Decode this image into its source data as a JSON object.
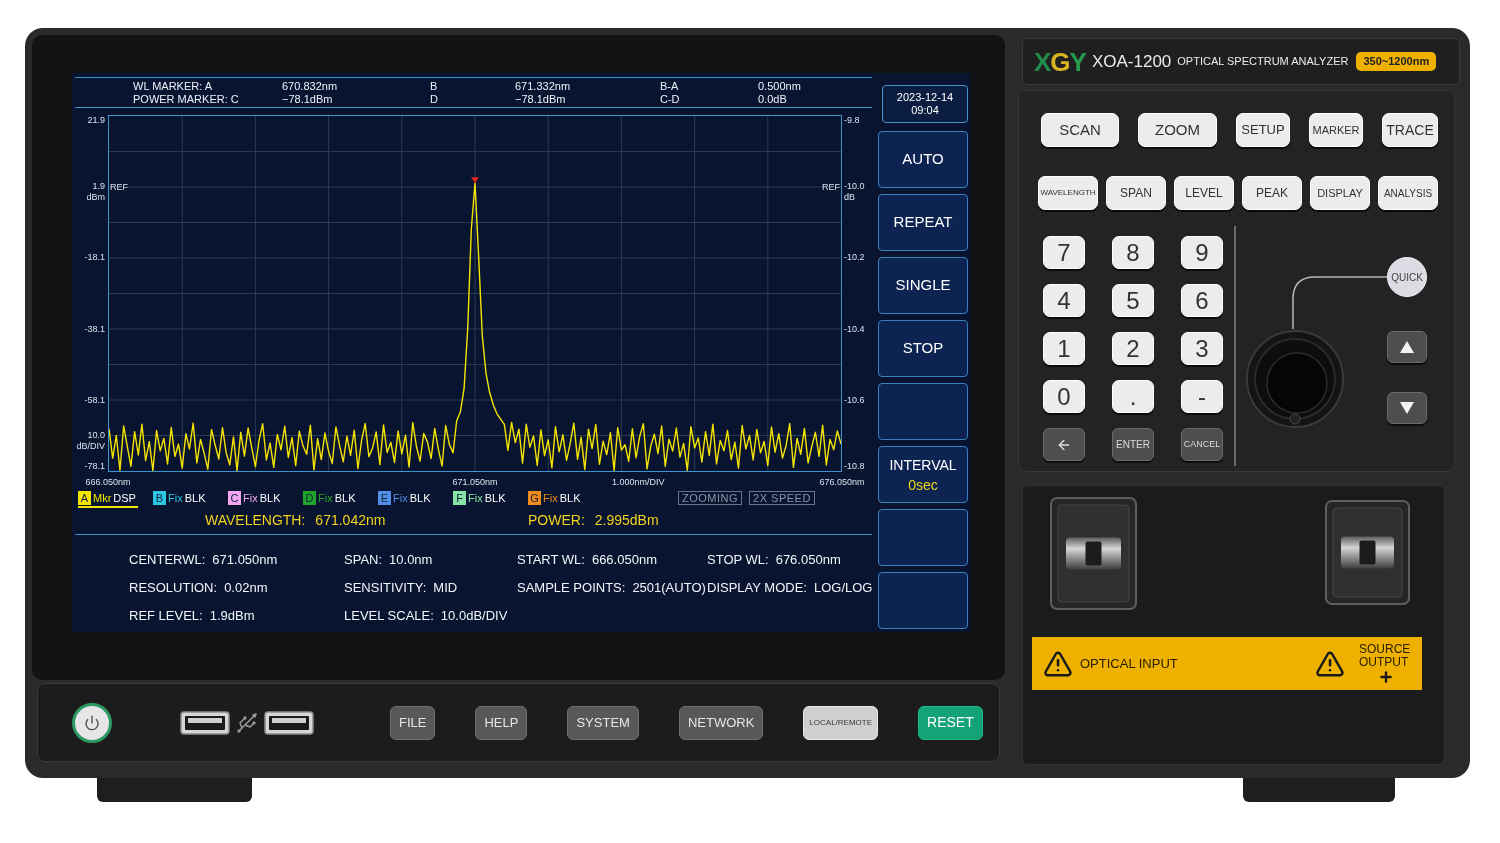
{
  "device": {
    "brand": "XGY",
    "model": "XOA-1200",
    "product": "OPTICAL SPECTRUM ANALYZER",
    "range_badge": "350~1200nm"
  },
  "screen": {
    "marker_table": [
      [
        "WL MARKER: A",
        "670.832nm",
        "B",
        "671.332nm",
        "B-A",
        "0.500nm"
      ],
      [
        "POWER MARKER: C",
        "−78.1dBm",
        "D",
        "−78.1dBm",
        "C-D",
        "0.0dB"
      ]
    ],
    "datetime": {
      "date": "2023-12-14",
      "time": "09:04"
    },
    "left_axis": {
      "ref_label": "REF",
      "unit": "dBm",
      "scale_value": "10.0",
      "scale_unit": "dB/DIV"
    },
    "right_axis": {
      "ref_label": "REF",
      "unit": "dB",
      "ticks": [
        "-9.8",
        "-10.0",
        "-10.2",
        "-10.4",
        "-10.6",
        "-10.8"
      ]
    },
    "x_scale": "1.000nm/DIV",
    "chart_data": {
      "type": "line",
      "grid": true,
      "xlim": [
        666.05,
        676.05
      ],
      "ylim": [
        -78.1,
        21.9
      ],
      "xticks": [
        {
          "value": 666.05,
          "label": "666.050nm"
        },
        {
          "value": 671.05,
          "label": "671.050nm"
        },
        {
          "value": 676.05,
          "label": "676.050nm"
        }
      ],
      "yticks": [
        21.9,
        1.9,
        -18.1,
        -38.1,
        -58.1,
        -78.1
      ],
      "x": [
        666.05,
        666.1,
        666.15,
        666.2,
        666.25,
        666.3,
        666.35,
        666.4,
        666.45,
        666.5,
        666.55,
        666.6,
        666.65,
        666.7,
        666.75,
        666.8,
        666.85,
        666.9,
        666.95,
        667,
        667.05,
        667.1,
        667.15,
        667.2,
        667.25,
        667.3,
        667.35,
        667.4,
        667.45,
        667.5,
        667.55,
        667.6,
        667.65,
        667.7,
        667.75,
        667.8,
        667.85,
        667.9,
        667.95,
        668,
        668.05,
        668.1,
        668.15,
        668.2,
        668.25,
        668.3,
        668.35,
        668.4,
        668.45,
        668.5,
        668.55,
        668.6,
        668.65,
        668.7,
        668.75,
        668.8,
        668.85,
        668.9,
        668.95,
        669,
        669.05,
        669.1,
        669.15,
        669.2,
        669.25,
        669.3,
        669.35,
        669.4,
        669.45,
        669.5,
        669.55,
        669.6,
        669.65,
        669.7,
        669.75,
        669.8,
        669.85,
        669.9,
        669.95,
        670,
        670.05,
        670.1,
        670.15,
        670.2,
        670.25,
        670.3,
        670.35,
        670.4,
        670.45,
        670.5,
        670.55,
        670.6,
        670.65,
        670.7,
        670.75,
        670.8,
        670.85,
        670.9,
        670.95,
        671,
        671.05,
        671.1,
        671.15,
        671.2,
        671.25,
        671.3,
        671.35,
        671.4,
        671.45,
        671.5,
        671.55,
        671.6,
        671.65,
        671.7,
        671.75,
        671.8,
        671.85,
        671.9,
        671.95,
        672,
        672.05,
        672.1,
        672.15,
        672.2,
        672.25,
        672.3,
        672.35,
        672.4,
        672.45,
        672.5,
        672.55,
        672.6,
        672.65,
        672.7,
        672.75,
        672.8,
        672.85,
        672.9,
        672.95,
        673,
        673.05,
        673.1,
        673.15,
        673.2,
        673.25,
        673.3,
        673.35,
        673.4,
        673.45,
        673.5,
        673.55,
        673.6,
        673.65,
        673.7,
        673.75,
        673.8,
        673.85,
        673.9,
        673.95,
        674,
        674.05,
        674.1,
        674.15,
        674.2,
        674.25,
        674.3,
        674.35,
        674.4,
        674.45,
        674.5,
        674.55,
        674.6,
        674.65,
        674.7,
        674.75,
        674.8,
        674.85,
        674.9,
        674.95,
        675,
        675.05,
        675.1,
        675.15,
        675.2,
        675.25,
        675.3,
        675.35,
        675.4,
        675.45,
        675.5,
        675.55,
        675.6,
        675.65,
        675.7,
        675.75,
        675.8,
        675.85,
        675.9,
        675.95,
        676,
        676.05
      ],
      "series": [
        {
          "color": "#f5e400",
          "values": [
            -66.2,
            -74.5,
            -68.1,
            -77.9,
            -65.4,
            -71.3,
            -76.8,
            -67.0,
            -73.6,
            -64.9,
            -75.2,
            -69.8,
            -78.0,
            -66.7,
            -72.4,
            -68.9,
            -76.1,
            -65.8,
            -74.0,
            -70.5,
            -77.3,
            -67.6,
            -71.9,
            -64.6,
            -75.8,
            -69.2,
            -73.1,
            -77.6,
            -66.4,
            -70.8,
            -74.7,
            -65.9,
            -72.8,
            -76.4,
            -68.5,
            -78.0,
            -67.2,
            -73.9,
            -66.0,
            -71.5,
            -76.9,
            -69.4,
            -64.8,
            -75.0,
            -70.2,
            -77.1,
            -67.8,
            -72.1,
            -65.5,
            -74.3,
            -68.7,
            -76.6,
            -66.9,
            -71.0,
            -73.4,
            -65.2,
            -77.8,
            -69.0,
            -74.9,
            -67.4,
            -72.6,
            -76.0,
            -65.7,
            -70.9,
            -75.5,
            -68.3,
            -73.7,
            -66.6,
            -77.4,
            -69.6,
            -64.7,
            -74.1,
            -71.7,
            -67.1,
            -76.3,
            -65.1,
            -72.9,
            -70.0,
            -75.7,
            -66.8,
            -73.3,
            -68.0,
            -77.0,
            -64.5,
            -71.2,
            -75.3,
            -67.5,
            -69.9,
            -74.6,
            -66.1,
            -72.0,
            -76.7,
            -65.3,
            -70.6,
            -73.0,
            -64.0,
            -61.5,
            -55.0,
            -38.0,
            -10.0,
            3.0,
            -18.0,
            -40.0,
            -50.5,
            -56.0,
            -59.5,
            -62.0,
            -63.5,
            -65.0,
            -72.3,
            -64.4,
            -70.1,
            -66.3,
            -75.9,
            -64.9,
            -71.4,
            -68.2,
            -76.5,
            -66.5,
            -73.8,
            -69.3,
            -77.2,
            -65.6,
            -72.7,
            -67.9,
            -75.1,
            -70.4,
            -64.6,
            -74.8,
            -68.6,
            -77.7,
            -66.3,
            -71.8,
            -65.0,
            -76.2,
            -69.7,
            -73.5,
            -67.3,
            -78.0,
            -65.9,
            -72.2,
            -70.7,
            -75.4,
            -66.2,
            -74.4,
            -68.4,
            -64.8,
            -77.5,
            -71.1,
            -67.7,
            -73.2,
            -65.4,
            -76.8,
            -69.1,
            -72.5,
            -66.0,
            -74.2,
            -70.3,
            -77.9,
            -65.6,
            -71.6,
            -68.8,
            -75.6,
            -67.0,
            -73.7,
            -64.9,
            -76.1,
            -69.5,
            -72.4,
            -66.7,
            -74.9,
            -70.0,
            -77.3,
            -65.3,
            -71.9,
            -68.1,
            -75.0,
            -66.4,
            -73.0,
            -69.8,
            -76.6,
            -65.7,
            -72.8,
            -67.6,
            -74.5,
            -70.9,
            -64.7,
            -77.1,
            -68.9,
            -73.4,
            -66.1,
            -75.8,
            -71.3,
            -67.2,
            -74.0,
            -65.2,
            -76.4,
            -69.2,
            -72.1,
            -66.8,
            -70.5
          ]
        }
      ]
    },
    "traces": [
      {
        "letter": "A",
        "mode": "Mkr",
        "status": "DSP",
        "color": "#f5e400",
        "selected": true
      },
      {
        "letter": "B",
        "mode": "Fix",
        "status": "BLK",
        "color": "#2ec6e6",
        "selected": false
      },
      {
        "letter": "C",
        "mode": "Fix",
        "status": "BLK",
        "color": "#f2a6f0",
        "selected": false
      },
      {
        "letter": "D",
        "mode": "Fix",
        "status": "BLK",
        "color": "#1fa52a",
        "selected": false
      },
      {
        "letter": "E",
        "mode": "Fix",
        "status": "BLK",
        "color": "#4f8fe8",
        "selected": false
      },
      {
        "letter": "F",
        "mode": "Fix",
        "status": "BLK",
        "color": "#86e3a6",
        "selected": false
      },
      {
        "letter": "G",
        "mode": "Fix",
        "status": "BLK",
        "color": "#f08a1c",
        "selected": false
      }
    ],
    "indicators": [
      {
        "label": "ZOOMING",
        "active": false
      },
      {
        "label": "2X SPEED",
        "active": false
      }
    ],
    "readout": [
      {
        "label": "WAVELENGTH:",
        "value": "671.042nm"
      },
      {
        "label": "POWER:",
        "value": "2.995dBm"
      }
    ],
    "settings": [
      {
        "label": "CENTERWL:",
        "value": "671.050nm"
      },
      {
        "label": "SPAN:",
        "value": "10.0nm"
      },
      {
        "label": "START WL:",
        "value": "666.050nm"
      },
      {
        "label": "STOP WL:",
        "value": "676.050nm"
      },
      {
        "label": "RESOLUTION:",
        "value": "0.02nm"
      },
      {
        "label": "SENSITIVITY:",
        "value": "MID"
      },
      {
        "label": "SAMPLE POINTS:",
        "value": "2501(AUTO)"
      },
      {
        "label": "DISPLAY MODE:",
        "value": "LOG/LOG"
      },
      {
        "label": "REF LEVEL:",
        "value": "1.9dBm"
      },
      {
        "label": "LEVEL SCALE:",
        "value": "10.0dB/DIV"
      }
    ],
    "softkeys": [
      {
        "kind": "label",
        "label": "AUTO"
      },
      {
        "kind": "label",
        "label": "REPEAT"
      },
      {
        "kind": "label",
        "label": "SINGLE"
      },
      {
        "kind": "label",
        "label": "STOP"
      },
      {
        "kind": "blank"
      },
      {
        "kind": "value",
        "label": "INTERVAL",
        "value": "0sec"
      },
      {
        "kind": "blank"
      },
      {
        "kind": "blank"
      }
    ]
  },
  "front_buttons": [
    {
      "label": "FILE",
      "kind": "menu"
    },
    {
      "label": "HELP",
      "kind": "menu"
    },
    {
      "label": "SYSTEM",
      "kind": "menu"
    },
    {
      "label": "NETWORK",
      "kind": "menu"
    },
    {
      "label": "LOCAL/REMOTE",
      "kind": "remote"
    },
    {
      "label": "RESET",
      "kind": "reset"
    }
  ],
  "keypad": {
    "function_rows": [
      [
        "SCAN",
        "ZOOM",
        "SETUP",
        "MARKER",
        "TRACE"
      ],
      [
        "WAVELENGTH",
        "SPAN",
        "LEVEL",
        "PEAK",
        "DISPLAY",
        "ANALYSIS"
      ]
    ],
    "number_keys": [
      "7",
      "8",
      "9",
      "4",
      "5",
      "6",
      "1",
      "2",
      "3",
      "0",
      ".",
      "-"
    ],
    "edit_keys": [
      "ENTER",
      "CANCEL"
    ],
    "quick": "QUICK"
  },
  "ports": {
    "input_label": "OPTICAL INPUT",
    "output_label": "SOURCE OUTPUT"
  }
}
